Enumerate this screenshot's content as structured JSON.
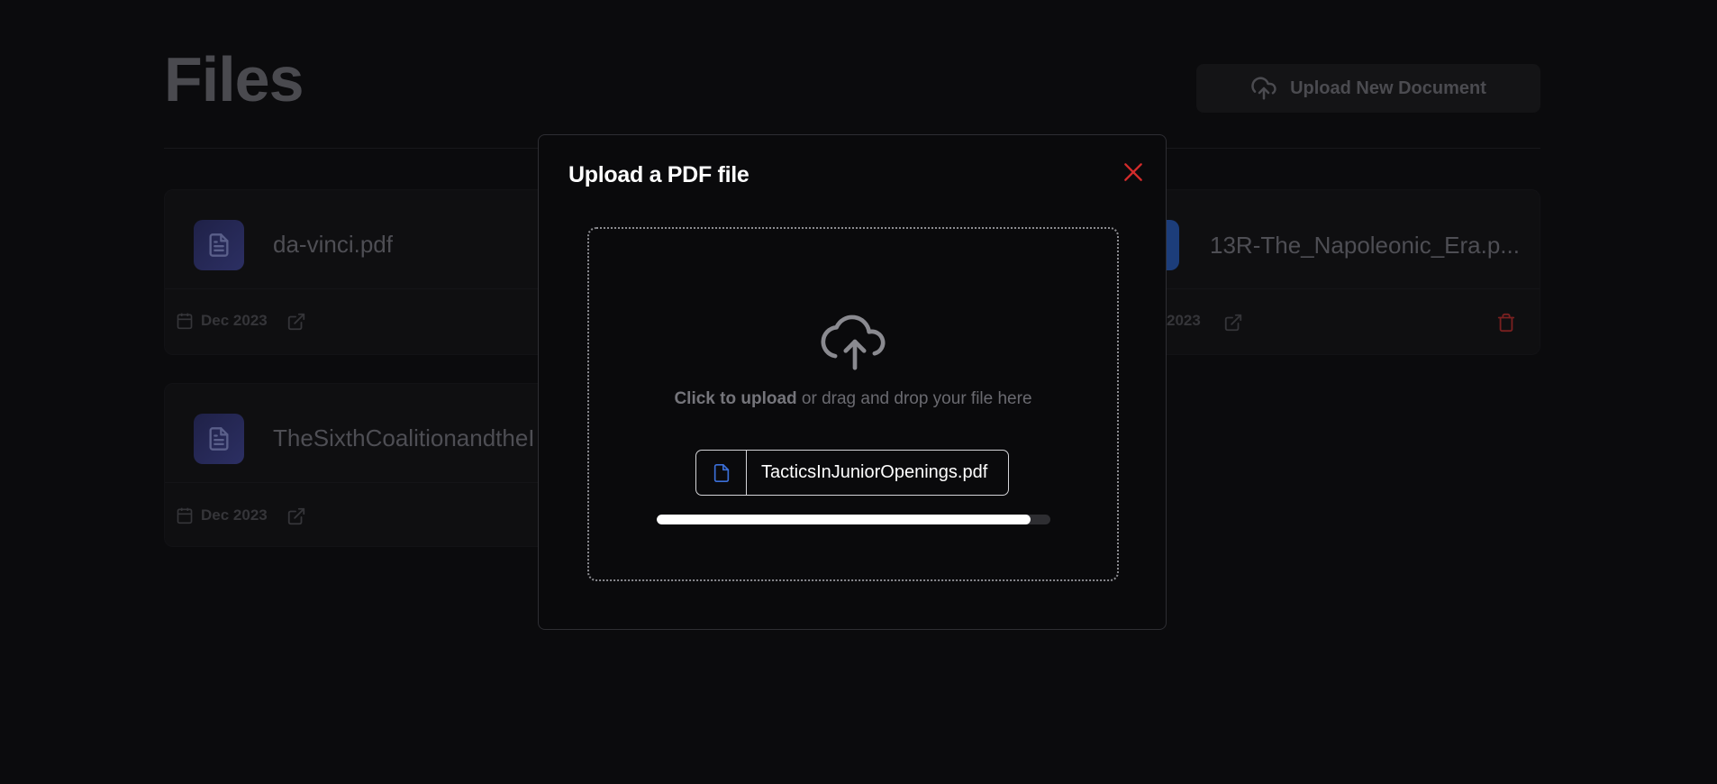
{
  "page": {
    "title": "Files",
    "upload_button_label": "Upload New Document"
  },
  "files": [
    {
      "name": "da-vinci.pdf",
      "date": "Dec 2023"
    },
    {
      "name": "13R-The_Napoleonic_Era.p...",
      "date": "2023"
    },
    {
      "name": "TheSixthCoalitionandtheI",
      "date": "Dec 2023"
    }
  ],
  "modal": {
    "title": "Upload a PDF file",
    "drop_strong": "Click to upload",
    "drop_rest": " or drag and drop your file here",
    "selected_file": "TacticsInJuniorOpenings.pdf",
    "progress_fraction": 0.95
  },
  "colors": {
    "close_icon": "#d22b2b",
    "trash_icon": "#7a2020",
    "chip_file_icon": "#3b6fd8"
  }
}
